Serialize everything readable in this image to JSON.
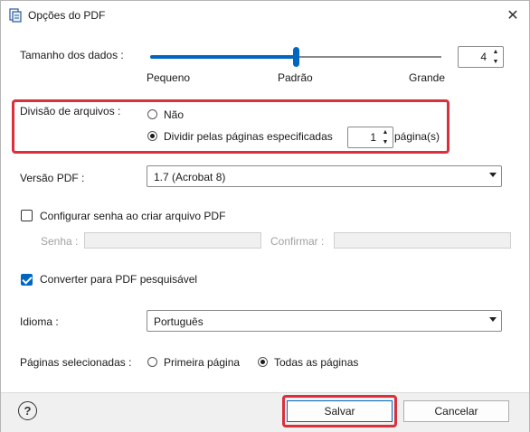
{
  "window": {
    "title": "Opções do PDF",
    "close_label": "✕"
  },
  "data_size": {
    "label": "Tamanho dos dados :",
    "min_label": "Pequeno",
    "mid_label": "Padrão",
    "max_label": "Grande",
    "slider_fraction": 0.5,
    "spin_value": "4"
  },
  "file_split": {
    "label": "Divisão de arquivos :",
    "option_no": "Não",
    "option_split": "Dividir pelas páginas especificadas",
    "pages_value": "1",
    "pages_unit": "página(s)",
    "selected": "split"
  },
  "pdf_version": {
    "label": "Versão PDF :",
    "value": "1.7 (Acrobat 8)"
  },
  "password": {
    "checkbox_label": "Configurar senha ao criar arquivo PDF",
    "checked": false,
    "password_label": "Senha :",
    "confirm_label": "Confirmar :",
    "password_value": "",
    "confirm_value": ""
  },
  "searchable": {
    "checkbox_label": "Converter para PDF pesquisável",
    "checked": true
  },
  "language": {
    "label": "Idioma :",
    "value": "Português"
  },
  "pages": {
    "label": "Páginas selecionadas :",
    "option_first": "Primeira página",
    "option_all": "Todas as páginas",
    "selected": "all"
  },
  "footer": {
    "help_glyph": "?",
    "save_label": "Salvar",
    "cancel_label": "Cancelar"
  },
  "colors": {
    "accent": "#0067c0",
    "highlight": "#d9303c"
  }
}
